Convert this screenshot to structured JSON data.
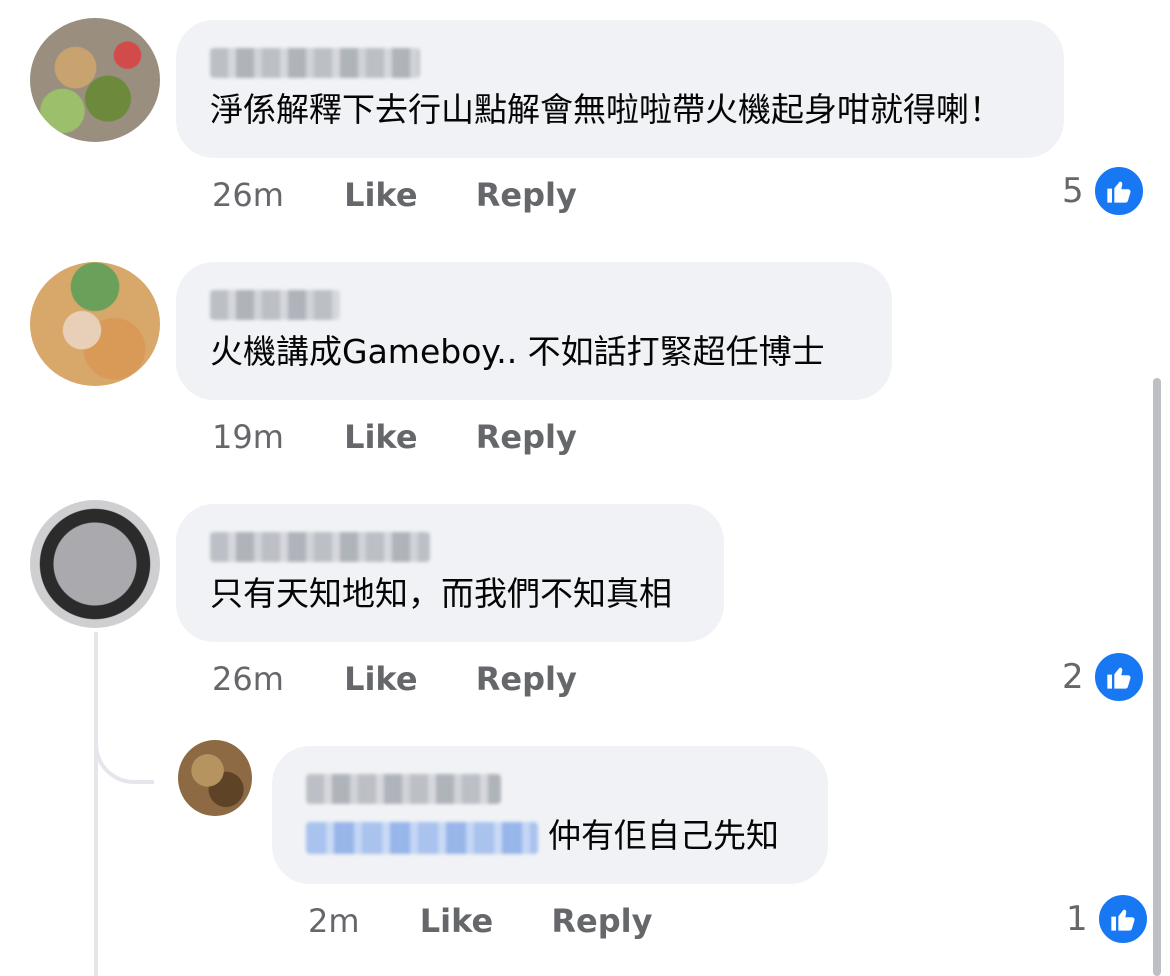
{
  "comments": [
    {
      "text": "淨係解釋下去行山點解會無啦啦帶火機起身咁就得喇！",
      "time": "26m",
      "like_label": "Like",
      "reply_label": "Reply",
      "reaction_count": "5"
    },
    {
      "text": "火機講成Gameboy.. 不如話打緊超任博士",
      "time": "19m",
      "like_label": "Like",
      "reply_label": "Reply"
    },
    {
      "text": "只有天知地知，而我們不知真相",
      "time": "26m",
      "like_label": "Like",
      "reply_label": "Reply",
      "reaction_count": "2"
    }
  ],
  "reply": {
    "text": "仲有佢自己先知",
    "time": "2m",
    "like_label": "Like",
    "reply_label": "Reply",
    "reaction_count": "1"
  },
  "colors": {
    "bubble": "#f0f2f5",
    "meta_text": "#65676b",
    "like_blue": "#1877f2"
  },
  "icons": {
    "reaction": "thumbs-up-icon"
  }
}
